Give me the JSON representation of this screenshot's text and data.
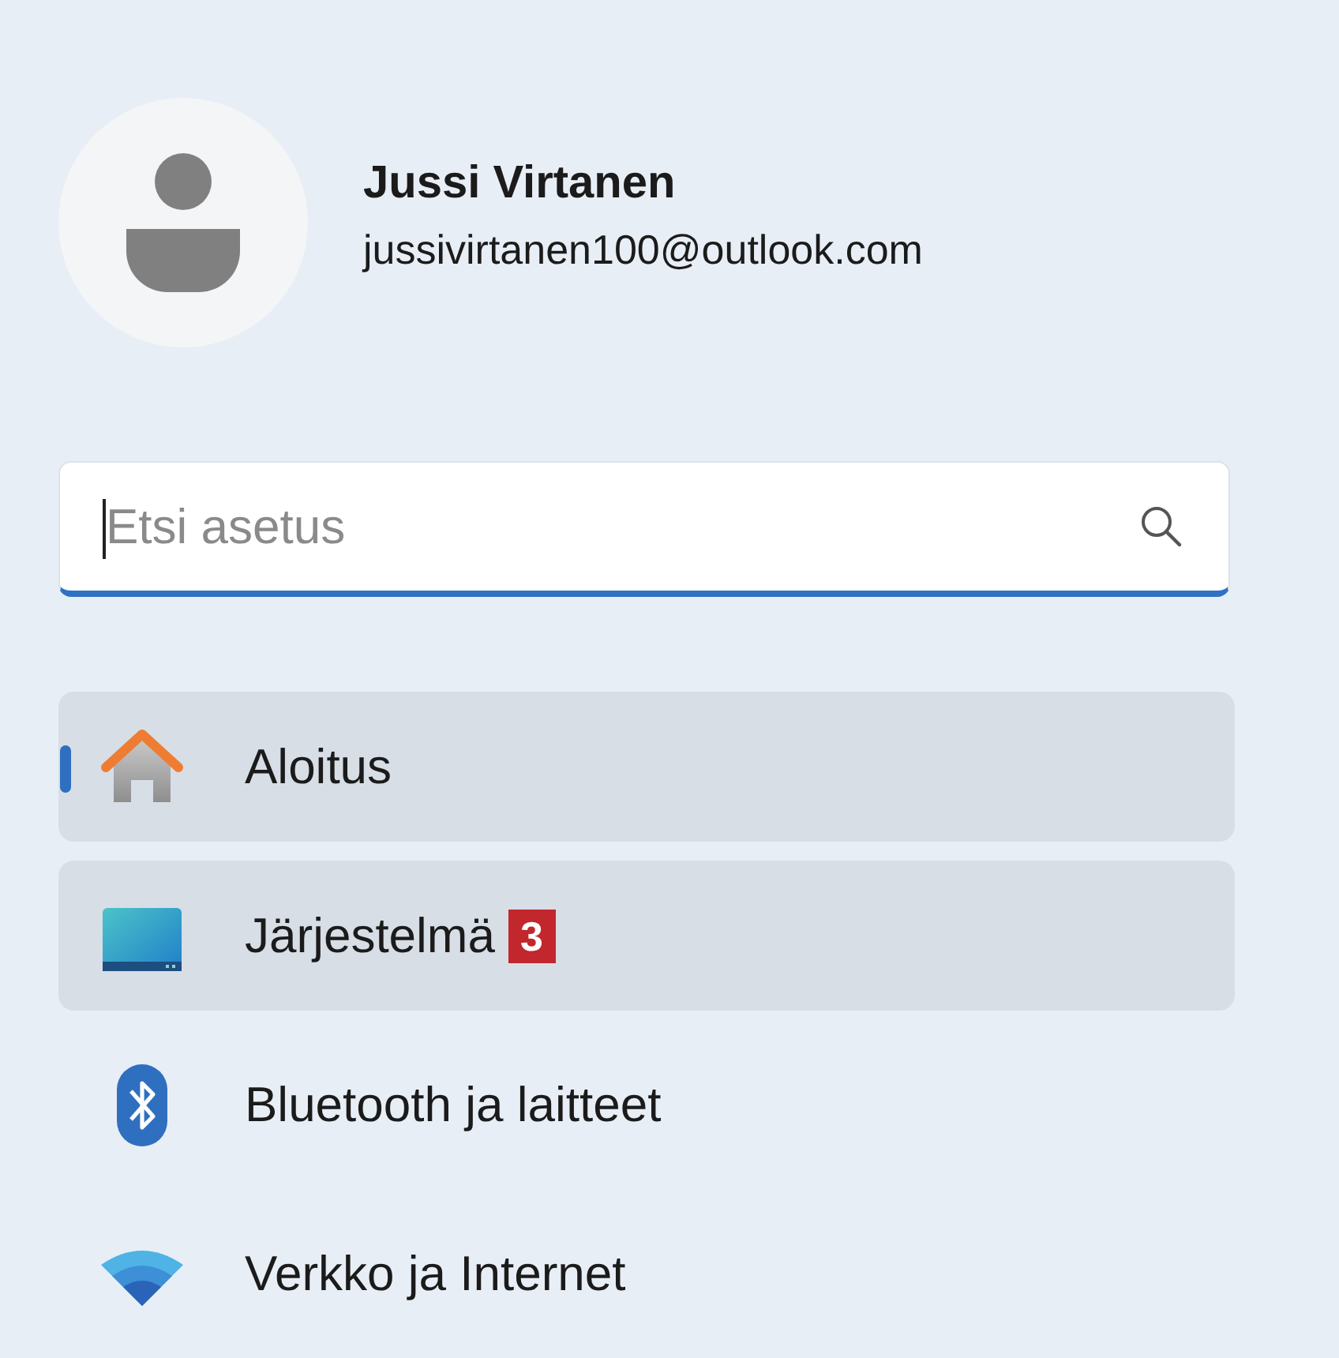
{
  "account": {
    "name": "Jussi Virtanen",
    "email": "jussivirtanen100@outlook.com"
  },
  "search": {
    "placeholder": "Etsi asetus",
    "focused": true
  },
  "nav": [
    {
      "kind": "home",
      "label": "Aloitus",
      "selected": true,
      "highlighted": true
    },
    {
      "kind": "system",
      "label": "Järjestelmä",
      "selected": false,
      "highlighted": true,
      "badge": "3"
    },
    {
      "kind": "bluetooth",
      "label": "Bluetooth ja laitteet",
      "selected": false,
      "highlighted": false
    },
    {
      "kind": "network",
      "label": "Verkko ja Internet",
      "selected": false,
      "highlighted": false
    }
  ]
}
